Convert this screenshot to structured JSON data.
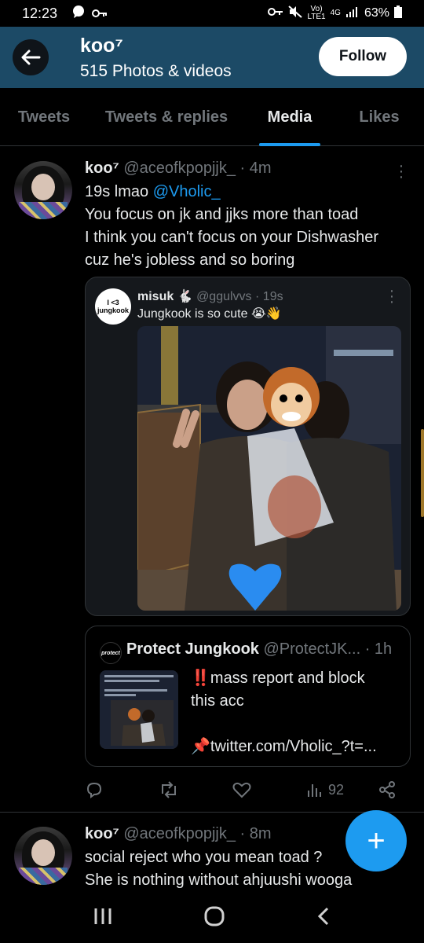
{
  "status_bar": {
    "time": "12:23",
    "network_volte": "Vo)",
    "network_lte": "LTE1",
    "network_gen": "4G",
    "battery": "63%"
  },
  "header": {
    "title": "koo⁷",
    "subtitle": "515 Photos & videos",
    "follow_label": "Follow"
  },
  "tabs": [
    {
      "label": "Tweets",
      "active": false
    },
    {
      "label": "Tweets & replies",
      "active": false
    },
    {
      "label": "Media",
      "active": true
    },
    {
      "label": "Likes",
      "active": false
    }
  ],
  "tweet1": {
    "name": "koo⁷",
    "handle": "@aceofkpopjjk_",
    "time": "· 4m",
    "line1_text": "19s lmao ",
    "line1_mention": "@Vholic_",
    "line2": "You focus on jk and jjks more than toad",
    "line3": "I think you can't focus on your Dishwasher",
    "line4": "cuz he's jobless and so boring",
    "quote": {
      "avatar_text": "I <3 jungkook",
      "name": "misuk 🐇",
      "handle": "@ggulvvs",
      "time": "· 19s",
      "text": "Jungkook is so cute 😭👋"
    },
    "quote2": {
      "avatar_text": "protect",
      "name": "Protect Jungkook",
      "handle": "@ProtectJK...",
      "time": "· 1h",
      "line1": "‼️mass report and block",
      "line2": "this acc",
      "line3": "📌twitter.com/Vholic_?t=..."
    },
    "views": "92"
  },
  "tweet2": {
    "name": "koo⁷",
    "handle": "@aceofkpopjjk_",
    "time": "· 8m",
    "line1": "social reject who you mean toad ?",
    "line2": "She is nothing without ahjuushi wooga"
  },
  "fab_label": "+",
  "nav": {
    "recents": "|||",
    "home": "○",
    "back": "<"
  }
}
